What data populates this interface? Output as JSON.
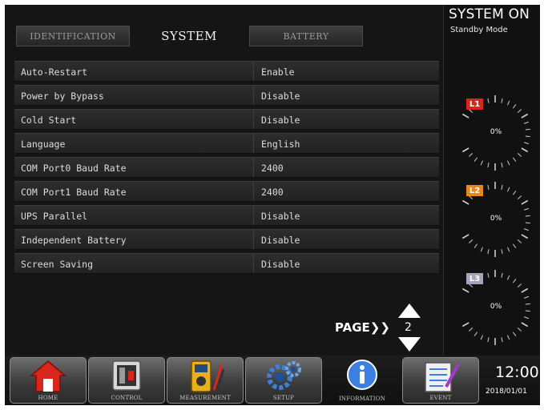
{
  "tabs": [
    {
      "label": "IDENTIFICATION",
      "active": false
    },
    {
      "label": "SYSTEM",
      "active": true
    },
    {
      "label": "BATTERY",
      "active": false
    }
  ],
  "settings": [
    {
      "label": "Auto-Restart",
      "value": "Enable"
    },
    {
      "label": "Power by Bypass",
      "value": "Disable"
    },
    {
      "label": "Cold Start",
      "value": "Disable"
    },
    {
      "label": "Language",
      "value": "English"
    },
    {
      "label": "COM Port0 Baud Rate",
      "value": "2400"
    },
    {
      "label": "COM Port1 Baud Rate",
      "value": "2400"
    },
    {
      "label": "UPS Parallel",
      "value": "Disable"
    },
    {
      "label": "Independent Battery",
      "value": "Disable"
    },
    {
      "label": "Screen Saving",
      "value": "Disable"
    }
  ],
  "pager": {
    "label": "PAGE❯❯",
    "page": "2"
  },
  "status": {
    "title": "SYSTEM ON",
    "mode": "Standby Mode"
  },
  "gauges": [
    {
      "label": "L1",
      "percent": "0%",
      "color": "#d8261b"
    },
    {
      "label": "L2",
      "percent": "0%",
      "color": "#e8871d"
    },
    {
      "label": "L3",
      "percent": "0%",
      "color": "#a9a2b8"
    }
  ],
  "toolbar": {
    "home": "HOME",
    "control": "CONTROL",
    "measurement": "MEASUREMENT",
    "setup": "SETUP",
    "information": "INFORMATION",
    "event": "EVENT"
  },
  "clock": {
    "time": "12:00",
    "date": "2018/01/01"
  }
}
